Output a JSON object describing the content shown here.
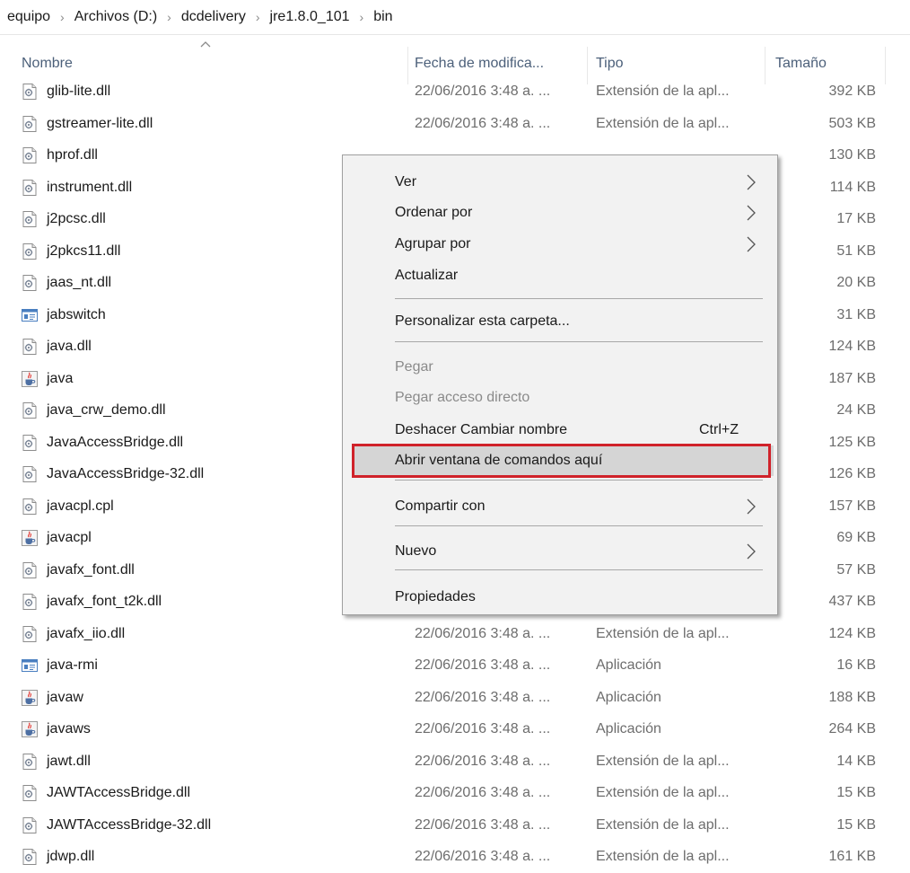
{
  "breadcrumb": [
    "equipo",
    "Archivos (D:)",
    "dcdelivery",
    "jre1.8.0_101",
    "bin"
  ],
  "columns": {
    "name": "Nombre",
    "date": "Fecha de modifica...",
    "type": "Tipo",
    "size": "Tamaño"
  },
  "files": [
    {
      "name": "glib-lite.dll",
      "date": "22/06/2016 3:48 a. ...",
      "type": "Extensión de la apl...",
      "size": "392 KB",
      "icon": "dll-file-icon"
    },
    {
      "name": "gstreamer-lite.dll",
      "date": "22/06/2016 3:48 a. ...",
      "type": "Extensión de la apl...",
      "size": "503 KB",
      "icon": "dll-file-icon"
    },
    {
      "name": "hprof.dll",
      "date": "",
      "type": "",
      "size": "130 KB",
      "icon": "dll-file-icon"
    },
    {
      "name": "instrument.dll",
      "date": "",
      "type": "",
      "size": "114 KB",
      "icon": "dll-file-icon"
    },
    {
      "name": "j2pcsc.dll",
      "date": "",
      "type": "",
      "size": "17 KB",
      "icon": "dll-file-icon"
    },
    {
      "name": "j2pkcs11.dll",
      "date": "",
      "type": "",
      "size": "51 KB",
      "icon": "dll-file-icon"
    },
    {
      "name": "jaas_nt.dll",
      "date": "",
      "type": "",
      "size": "20 KB",
      "icon": "dll-file-icon"
    },
    {
      "name": "jabswitch",
      "date": "",
      "type": "",
      "size": "31 KB",
      "icon": "app-window-icon"
    },
    {
      "name": "java.dll",
      "date": "",
      "type": "",
      "size": "124 KB",
      "icon": "dll-file-icon"
    },
    {
      "name": "java",
      "date": "",
      "type": "",
      "size": "187 KB",
      "icon": "java-icon"
    },
    {
      "name": "java_crw_demo.dll",
      "date": "",
      "type": "",
      "size": "24 KB",
      "icon": "dll-file-icon"
    },
    {
      "name": "JavaAccessBridge.dll",
      "date": "",
      "type": "",
      "size": "125 KB",
      "icon": "dll-file-icon"
    },
    {
      "name": "JavaAccessBridge-32.dll",
      "date": "",
      "type": "",
      "size": "126 KB",
      "icon": "dll-file-icon"
    },
    {
      "name": "javacpl.cpl",
      "date": "",
      "type": "",
      "size": "157 KB",
      "icon": "dll-file-icon"
    },
    {
      "name": "javacpl",
      "date": "",
      "type": "",
      "size": "69 KB",
      "icon": "java-icon"
    },
    {
      "name": "javafx_font.dll",
      "date": "",
      "type": "",
      "size": "57 KB",
      "icon": "dll-file-icon"
    },
    {
      "name": "javafx_font_t2k.dll",
      "date": "",
      "type": "",
      "size": "437 KB",
      "icon": "dll-file-icon"
    },
    {
      "name": "javafx_iio.dll",
      "date": "22/06/2016 3:48 a. ...",
      "type": "Extensión de la apl...",
      "size": "124 KB",
      "icon": "dll-file-icon"
    },
    {
      "name": "java-rmi",
      "date": "22/06/2016 3:48 a. ...",
      "type": "Aplicación",
      "size": "16 KB",
      "icon": "app-window-icon"
    },
    {
      "name": "javaw",
      "date": "22/06/2016 3:48 a. ...",
      "type": "Aplicación",
      "size": "188 KB",
      "icon": "java-icon"
    },
    {
      "name": "javaws",
      "date": "22/06/2016 3:48 a. ...",
      "type": "Aplicación",
      "size": "264 KB",
      "icon": "java-icon"
    },
    {
      "name": "jawt.dll",
      "date": "22/06/2016 3:48 a. ...",
      "type": "Extensión de la apl...",
      "size": "14 KB",
      "icon": "dll-file-icon"
    },
    {
      "name": "JAWTAccessBridge.dll",
      "date": "22/06/2016 3:48 a. ...",
      "type": "Extensión de la apl...",
      "size": "15 KB",
      "icon": "dll-file-icon"
    },
    {
      "name": "JAWTAccessBridge-32.dll",
      "date": "22/06/2016 3:48 a. ...",
      "type": "Extensión de la apl...",
      "size": "15 KB",
      "icon": "dll-file-icon"
    },
    {
      "name": "jdwp.dll",
      "date": "22/06/2016 3:48 a. ...",
      "type": "Extensión de la apl...",
      "size": "161 KB",
      "icon": "dll-file-icon"
    }
  ],
  "context_menu": {
    "items": [
      {
        "label": "Ver",
        "submenu": true
      },
      {
        "label": "Ordenar por",
        "submenu": true
      },
      {
        "label": "Agrupar por",
        "submenu": true
      },
      {
        "label": "Actualizar"
      },
      {
        "label": "Personalizar esta carpeta..."
      },
      {
        "label": "Pegar",
        "disabled": true
      },
      {
        "label": "Pegar acceso directo",
        "disabled": true
      },
      {
        "label": "Deshacer Cambiar nombre",
        "shortcut": "Ctrl+Z"
      },
      {
        "label": "Abrir ventana de comandos aquí",
        "highlighted": true
      },
      {
        "label": "Compartir con",
        "submenu": true
      },
      {
        "label": "Nuevo",
        "submenu": true
      },
      {
        "label": "Propiedades"
      }
    ]
  },
  "colors": {
    "highlight_border": "#d0222a",
    "menu_background": "#f2f2f2",
    "header_text": "#4c607a"
  }
}
